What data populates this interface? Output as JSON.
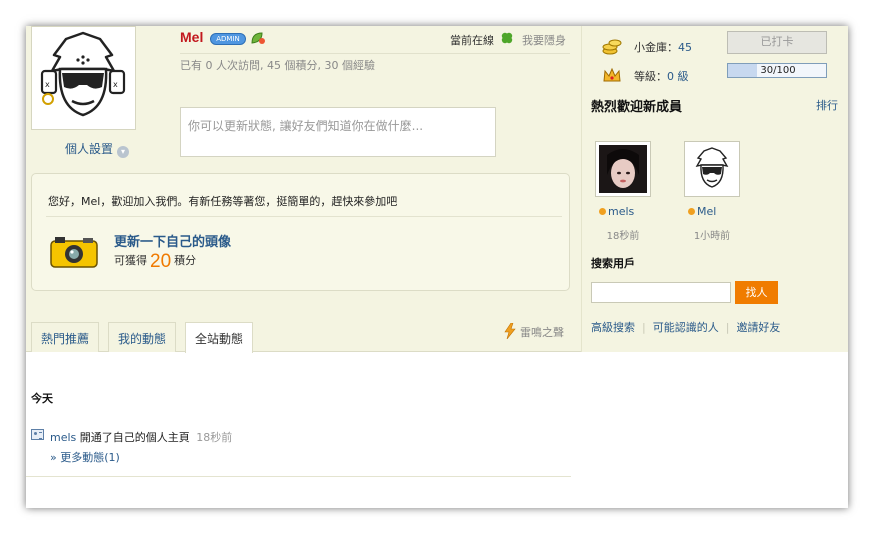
{
  "profile": {
    "username": "Mel",
    "admin_badge": "ADMIN",
    "settings_label": "個人設置",
    "online_label": "當前在線",
    "hide_label": "我要隱身",
    "stats_text": "已有 0 人次訪問, 45 個積分, 30 個經驗",
    "status_placeholder": "你可以更新狀態, 讓好友們知道你在做什麼..."
  },
  "welcome": {
    "message": "您好，Mel，歡迎加入我們。有新任務等著您，挺簡單的，趕快來參加吧",
    "task_title": "更新一下自己的頭像",
    "reward_prefix": "可獲得",
    "reward_points": "20",
    "reward_suffix": "積分"
  },
  "tabs": [
    {
      "label": "熱門推薦",
      "active": false
    },
    {
      "label": "我的動態",
      "active": false
    },
    {
      "label": "全站動態",
      "active": true
    }
  ],
  "thunder_label": "雷鳴之聲",
  "feed": {
    "day_label": "今天",
    "items": [
      {
        "user": "mels",
        "action": "開通了自己的個人主頁",
        "time": "18秒前"
      }
    ],
    "more_label": "» 更多動態(1)"
  },
  "sidebar": {
    "vault_label": "小金庫：",
    "vault_value": "45",
    "level_label": "等級：",
    "level_value": "0 級",
    "checkin_label": "已打卡",
    "progress_text": "30/100",
    "progress_fraction": 0.3,
    "new_members_title": "熱烈歡迎新成員",
    "rank_label": "排行",
    "members": [
      {
        "name": "mels",
        "time": "18秒前"
      },
      {
        "name": "Mel",
        "time": "1小時前"
      }
    ],
    "search_title": "搜索用戶",
    "search_button": "找人",
    "links": [
      "高級搜索",
      "可能認識的人",
      "邀請好友"
    ]
  },
  "colors": {
    "band_bg": "#f4f4e1",
    "link": "#2a5a8a",
    "username": "#c2181e",
    "accent": "#f07c00"
  }
}
